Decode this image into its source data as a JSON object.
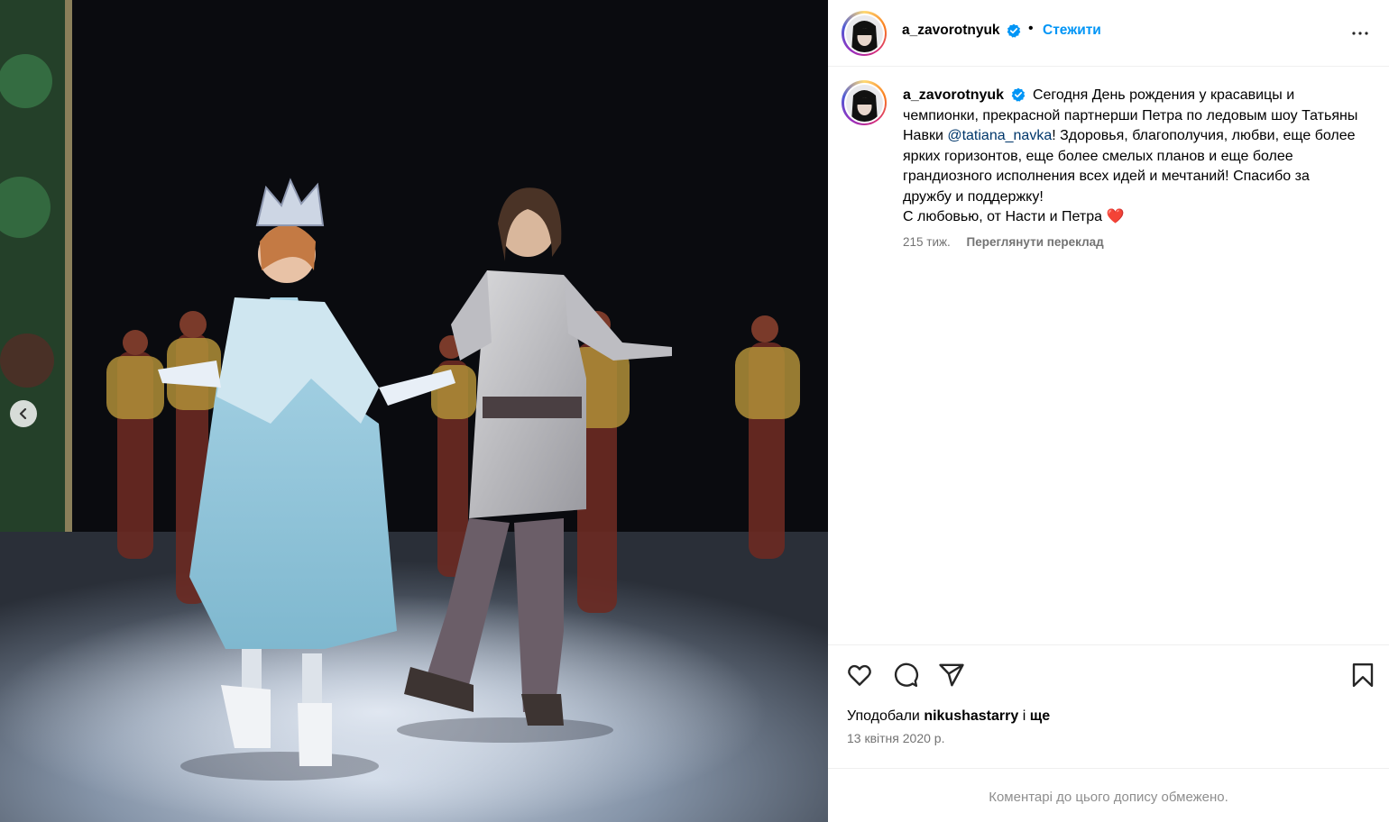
{
  "post": {
    "username": "a_zavorotnyuk",
    "verified": true,
    "follow_label": "Стежити",
    "more_icon": "more-horizontal-icon"
  },
  "caption": {
    "username": "a_zavorotnyuk",
    "text_before_mention": "Сегодня День рождения у красавицы и чемпионки, прекрасной партнерши Петра по ледовым шоу Татьяны Навки ",
    "mention": "@tatiana_navka",
    "text_after_mention": "! Здоровья, благополучия, любви, еще более ярких горизонтов, еще более смелых планов и еще более грандиозного исполнения всех идей и мечтаний! Спасибо за дружбу и поддержку!",
    "signoff": "С любовью, от Насти и Петра ",
    "emoji": "❤️",
    "age": "215 тиж.",
    "translate_label": "Переглянути переклад"
  },
  "actions": {
    "like_icon": "heart-icon",
    "comment_icon": "comment-icon",
    "share_icon": "share-icon",
    "save_icon": "bookmark-icon"
  },
  "likes": {
    "prefix": "Уподобали ",
    "user": "nikushastarry",
    "joiner": " і ",
    "more": "ще"
  },
  "date": "13 квітня 2020 р.",
  "comments_notice": "Коментарі до цього допису обмежено.",
  "colors": {
    "link_blue": "#0095f6",
    "mention_blue": "#00376b",
    "muted": "#737373",
    "heart_red": "#ed4956"
  }
}
